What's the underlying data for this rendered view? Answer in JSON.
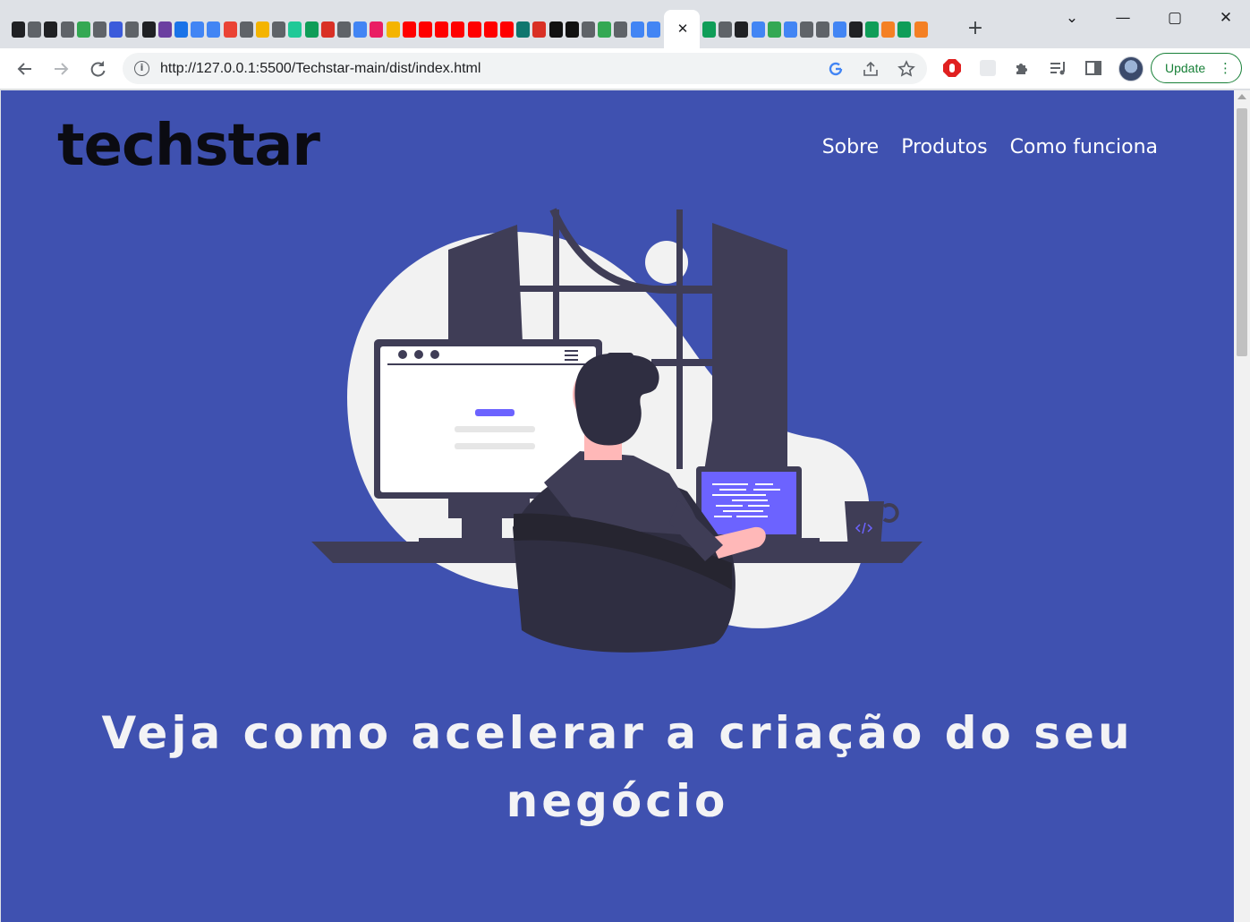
{
  "browser": {
    "tab_close_glyph": "✕",
    "new_tab_glyph": "+",
    "window_controls": {
      "minimize": "—",
      "maximize": "▢",
      "close": "✕",
      "tabsearch": "⌄"
    },
    "url": "http://127.0.0.1:5500/Techstar-main/dist/index.html",
    "update_label": "Update",
    "tab_favicon_colors": [
      "#202124",
      "#5f6368",
      "#202124",
      "#5f6368",
      "#34a853",
      "#5f6368",
      "#3b5bdb",
      "#5f6368",
      "#202124",
      "#6b3fa0",
      "#1a73e8",
      "#4285f4",
      "#4285f4",
      "#ea4335",
      "#5f6368",
      "#f4b400",
      "#5f6368",
      "#20c997",
      "#0f9d58",
      "#d93025",
      "#5f6368",
      "#4285f4",
      "#e91e63",
      "#f4b400",
      "#ff0000",
      "#ff0000",
      "#ff0000",
      "#ff0000",
      "#ff0000",
      "#ff0000",
      "#ff0000",
      "#0f766e",
      "#d93025",
      "#111111",
      "#111111",
      "#5f6368",
      "#34a853",
      "#5f6368",
      "#4285f4",
      "#4285f4"
    ],
    "tab_favicon_colors_right": [
      "#0f9d58",
      "#5f6368",
      "#202124",
      "#4285f4",
      "#34a853",
      "#4285f4",
      "#5f6368",
      "#5f6368",
      "#4285f4",
      "#202124",
      "#0f9d58",
      "#f48024",
      "#0f9d58",
      "#f48024"
    ],
    "accent_color": "#188038"
  },
  "page": {
    "logo": "techstar",
    "nav": [
      "Sobre",
      "Produtos",
      "Como funciona"
    ],
    "headline_line1": "Veja como acelerar a criação do seu",
    "headline_line2": "negócio",
    "background_color": "#3f51b0",
    "illustration_primary_color": "#6c63ff",
    "illustration_dark_color": "#3f3d56"
  }
}
